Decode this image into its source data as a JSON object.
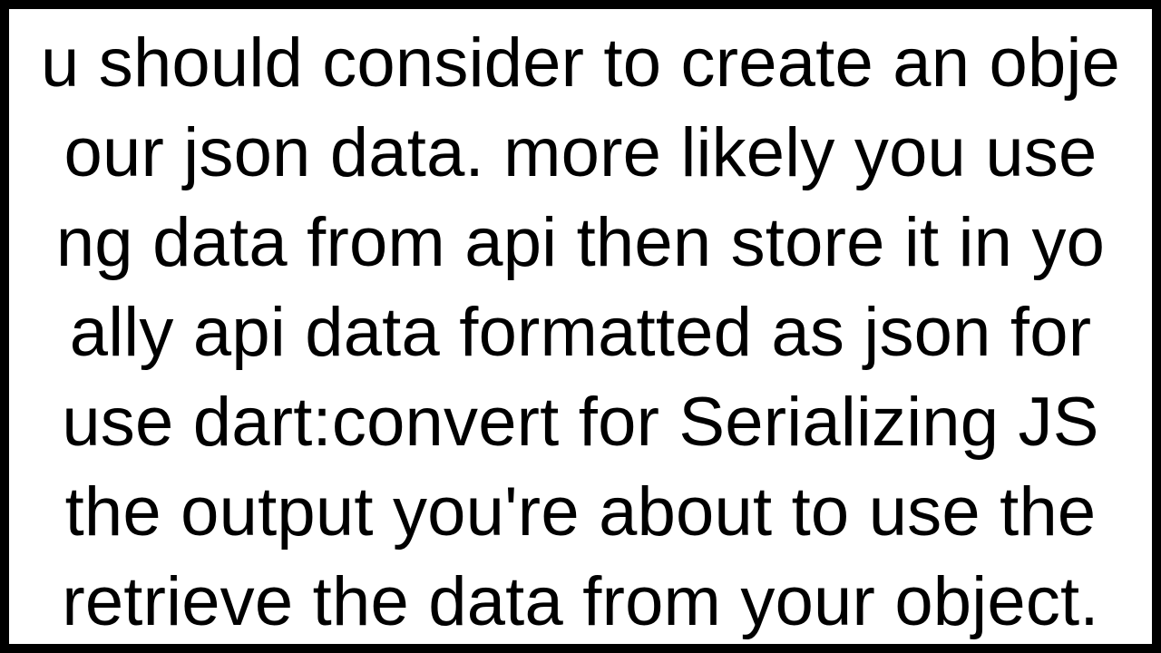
{
  "document": {
    "lines": [
      "u should consider to create an obje",
      "our json data. more likely you use ",
      "ng data from api then store it in yo",
      "ally api data formatted as json for ",
      " use dart:convert for Serializing JS",
      " the output you're about to use the",
      "retrieve the data from your object."
    ]
  }
}
